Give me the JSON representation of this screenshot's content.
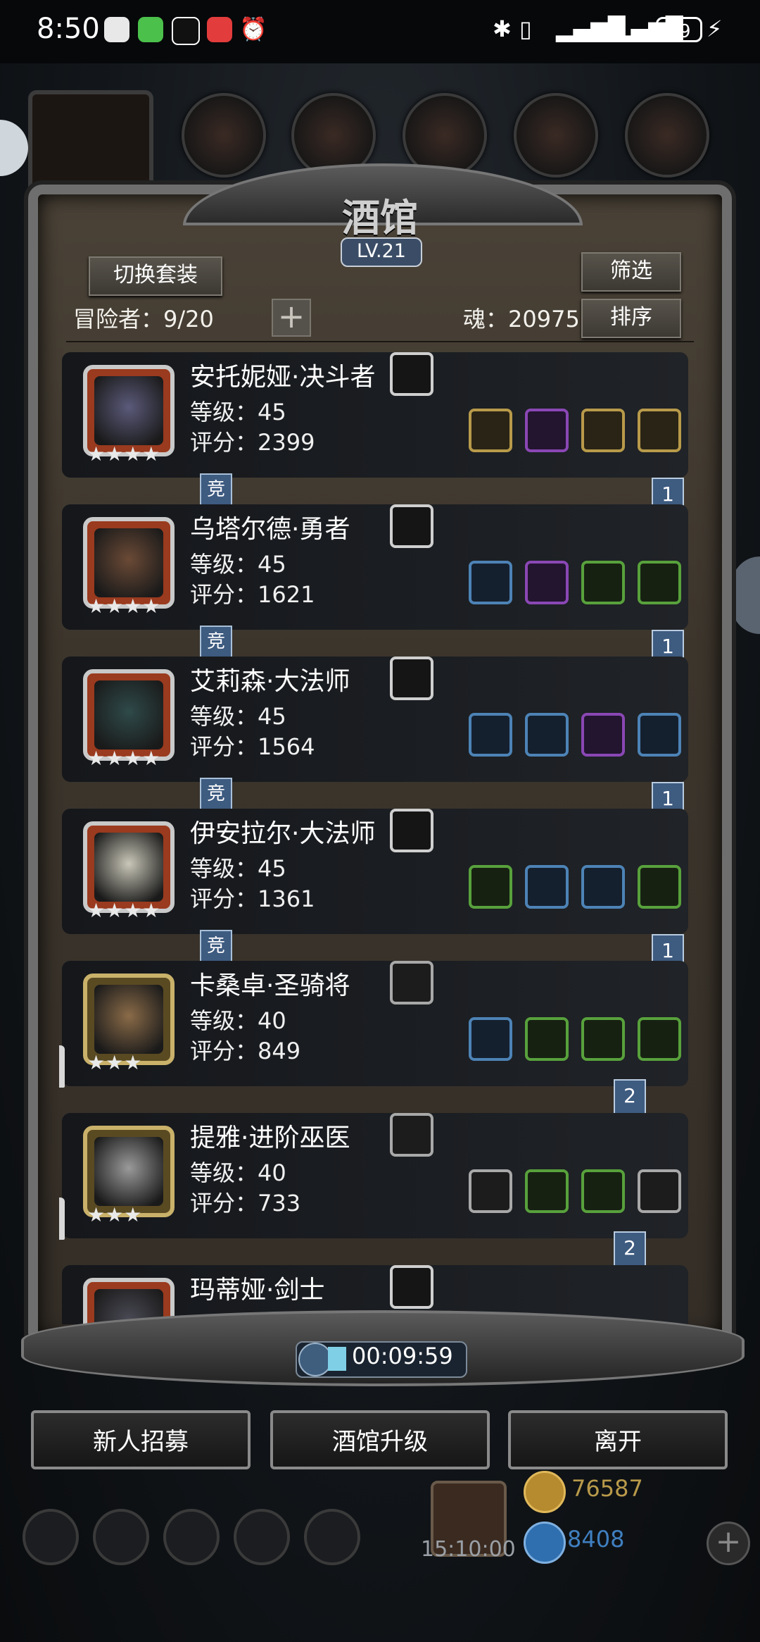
{
  "status_bar": {
    "time": "8:50",
    "battery": "59",
    "right_icons": [
      "bluetooth-icon",
      "vibrate-icon",
      "signal-icon",
      "signal-icon",
      "battery-icon",
      "charging-icon"
    ]
  },
  "panel": {
    "title": "酒馆",
    "level": "LV.21",
    "switch_outfit_label": "切换套装",
    "filter_label": "筛选",
    "sort_label": "排序",
    "adventurers_label": "冒险者：9/20",
    "soul_label": "魂：20975",
    "plus_label": "+"
  },
  "heroes": [
    {
      "name": "安托妮娅·决斗者",
      "level": "等级：45",
      "score": "评分：2399",
      "stars": "★★★★",
      "badge": "竞",
      "flag": "1",
      "rune": {
        "color": "white",
        "icon": "stone-rune-icon"
      },
      "equipment": [
        {
          "color": "gold",
          "icon": "rapier-icon"
        },
        {
          "color": "purple",
          "icon": "helmet-icon"
        },
        {
          "color": "gold",
          "icon": "armor-icon"
        },
        {
          "color": "gold",
          "icon": "amulet-icon"
        }
      ]
    },
    {
      "name": "乌塔尔德·勇者",
      "level": "等级：45",
      "score": "评分：1621",
      "stars": "★★★★",
      "badge": "竞",
      "flag": "1",
      "rune": {
        "color": "white",
        "icon": "stone-rune-icon"
      },
      "equipment": [
        {
          "color": "blue",
          "icon": "axe-icon"
        },
        {
          "color": "purple",
          "icon": "armor-icon"
        },
        {
          "color": "green",
          "icon": "shield-icon"
        },
        {
          "color": "green",
          "icon": "shield-icon"
        }
      ]
    },
    {
      "name": "艾莉森·大法师",
      "level": "等级：45",
      "score": "评分：1564",
      "stars": "★★★★",
      "badge": "竞",
      "flag": "1",
      "rune": {
        "color": "white",
        "icon": "brain-rune-icon"
      },
      "equipment": [
        {
          "color": "blue",
          "icon": "staff-icon"
        },
        {
          "color": "blue",
          "icon": "armor-icon"
        },
        {
          "color": "purple",
          "icon": "armor-icon"
        },
        {
          "color": "blue",
          "icon": "necklace-icon"
        }
      ]
    },
    {
      "name": "伊安拉尔·大法师",
      "level": "等级：45",
      "score": "评分：1361",
      "stars": "★★★★",
      "badge": "竞",
      "flag": "1",
      "rune": {
        "color": "white",
        "icon": "axe-rune-icon"
      },
      "equipment": [
        {
          "color": "green",
          "icon": "wand-icon"
        },
        {
          "color": "blue",
          "icon": "armor-icon"
        },
        {
          "color": "blue",
          "icon": "shield-icon"
        },
        {
          "color": "green",
          "icon": "shield-icon"
        }
      ]
    },
    {
      "name": "卡桑卓·圣骑将",
      "level": "等级：40",
      "score": "评分：849",
      "stars": "★★★",
      "badge": "",
      "flag": "2",
      "rune": {
        "color": "grey",
        "icon": "heal-rune-icon"
      },
      "equipment": [
        {
          "color": "blue",
          "icon": "hammer-icon"
        },
        {
          "color": "green",
          "icon": "armor-icon"
        },
        {
          "color": "green",
          "icon": "plank-icon"
        },
        {
          "color": "green",
          "icon": "necklace-icon"
        }
      ]
    },
    {
      "name": "提雅·进阶巫医",
      "level": "等级：40",
      "score": "评分：733",
      "stars": "★★★",
      "badge": "",
      "flag": "2",
      "rune": {
        "color": "grey",
        "icon": "heal-rune-icon"
      },
      "equipment": [
        {
          "color": "grey",
          "icon": "healing-staff-icon"
        },
        {
          "color": "green",
          "icon": "armor-icon"
        },
        {
          "color": "green",
          "icon": "necklace-icon"
        },
        {
          "color": "grey",
          "icon": "claw-icon"
        }
      ]
    },
    {
      "name": "玛蒂娅·剑士",
      "level": "",
      "score": "",
      "stars": "",
      "badge": "",
      "flag": "",
      "rune": {
        "color": "white",
        "icon": "fang-rune-icon"
      },
      "equipment": []
    }
  ],
  "timer": {
    "value": "00:09:59"
  },
  "buttons": {
    "recruit": "新人招募",
    "upgrade": "酒馆升级",
    "leave": "离开"
  },
  "bottom": {
    "gift_timer": "15:10:00",
    "gold": "76587",
    "gems": "8408",
    "plus": "+"
  },
  "colors": {
    "gold": "#b89a4a",
    "purple": "#8a47b4",
    "blue": "#4d83b6",
    "green": "#58a13c",
    "badge": "#3e5b80"
  }
}
